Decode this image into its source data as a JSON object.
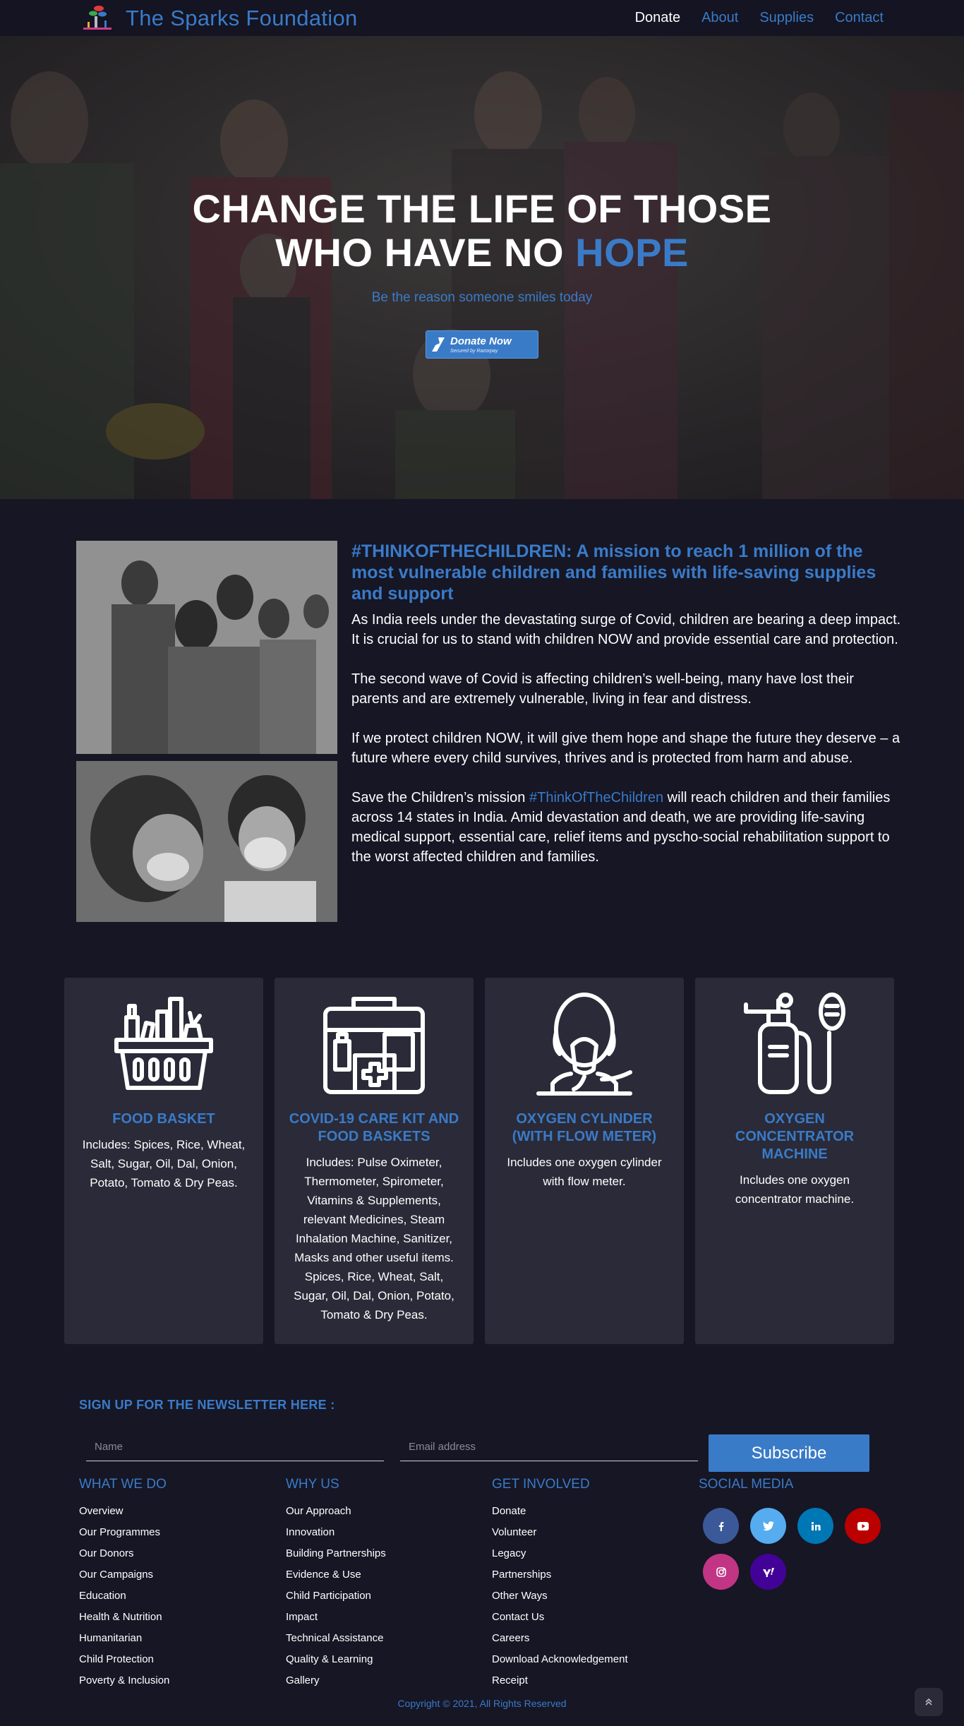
{
  "nav": {
    "brand": "The Sparks Foundation",
    "links": [
      "Donate",
      "About",
      "Supplies",
      "Contact"
    ],
    "active_color": "#ffffff",
    "link_color": "#3a7bc8"
  },
  "hero": {
    "title_line1": "CHANGE THE LIFE OF THOSE",
    "title_line2_prefix": "WHO HAVE NO",
    "title_line2_highlight": "HOPE",
    "subtitle": "Be the reason someone smiles today",
    "donate_button": {
      "label": "Donate Now",
      "sublabel": "Secured by Razorpay",
      "icon": "razorpay-icon"
    }
  },
  "mission": {
    "title": "#THINKOFTHECHILDREN: A mission to reach 1 million of the most vulnerable children and families with life-saving supplies and support",
    "paragraphs": [
      "As India reels under the devastating surge of Covid, children are bearing a deep impact. It is crucial for us to stand with children NOW and provide essential care and protection.",
      "The second wave of Covid is affecting children’s well-being, many have lost their parents and are extremely vulnerable, living in fear and distress.",
      "If we protect children NOW, it will give them hope and shape the future they deserve – a future where every child survives, thrives and is protected from harm and abuse."
    ],
    "last_para_prefix": "Save the Children’s mission",
    "last_para_highlight": "#ThinkOfTheChildren",
    "last_para_suffix": "will reach children and their families across 14 states in India. Amid devastation and death, we are providing life-saving medical support, essential care, relief items and pyscho-social rehabilitation support to the worst affected children and families."
  },
  "cards": [
    {
      "icon": "food-basket-icon",
      "title": "FOOD BASKET",
      "text": "Includes: Spices, Rice, Wheat, Salt, Sugar, Oil, Dal, Onion, Potato, Tomato & Dry Peas."
    },
    {
      "icon": "medical-kit-icon",
      "title": "COVID-19 CARE KIT AND FOOD BASKETS",
      "text": "Includes: Pulse Oximeter, Thermometer, Spirometer, Vitamins & Supplements, relevant Medicines, Steam Inhalation Machine, Sanitizer, Masks and other useful items. Spices, Rice, Wheat, Salt, Sugar, Oil, Dal, Onion, Potato, Tomato & Dry Peas."
    },
    {
      "icon": "oxygen-mask-icon",
      "title": "OXYGEN CYLINDER (WITH FLOW METER)",
      "text": "Includes one oxygen cylinder with flow meter."
    },
    {
      "icon": "oxygen-concentrator-icon",
      "title": "OXYGEN CONCENTRATOR MACHINE",
      "text": "Includes one oxygen concentrator machine."
    }
  ],
  "newsletter": {
    "title": "SIGN UP FOR THE NEWSLETTER HERE :",
    "name_placeholder": "Name",
    "email_placeholder": "Email address",
    "subscribe_label": "Subscribe"
  },
  "footer": {
    "what_we_do": {
      "heading": "WHAT WE DO",
      "items": [
        "Overview",
        "Our Programmes",
        "Our Donors",
        "Our Campaigns",
        "Education",
        "Health & Nutrition",
        "Humanitarian",
        "Child Protection",
        "Poverty & Inclusion"
      ]
    },
    "why_us": {
      "heading": "WHY US",
      "items": [
        "Our Approach",
        "Innovation",
        "Building Partnerships",
        "Evidence & Use",
        "Child Participation",
        "Impact",
        "Technical Assistance",
        "Quality & Learning",
        "Gallery"
      ]
    },
    "get_involved": {
      "heading": "GET INVOLVED",
      "items": [
        "Donate",
        "Volunteer",
        "Legacy",
        "Partnerships",
        "Other Ways",
        "Contact Us",
        "Careers",
        "Download Acknowledgement",
        "Receipt"
      ]
    },
    "social": {
      "heading": "SOCIAL MEDIA",
      "items": [
        {
          "icon": "facebook-icon",
          "color": "#3b5998",
          "glyph": "f"
        },
        {
          "icon": "twitter-icon",
          "color": "#55acee",
          "glyph": "t"
        },
        {
          "icon": "linkedin-icon",
          "color": "#0077b5",
          "glyph": "in"
        },
        {
          "icon": "youtube-icon",
          "color": "#bb0000",
          "glyph": "▶"
        },
        {
          "icon": "instagram-icon",
          "color": "#c13584",
          "glyph": "◎"
        },
        {
          "icon": "yahoo-icon",
          "color": "#430297",
          "glyph": "y!"
        }
      ]
    },
    "copyright": "Copyright © 2021, All Rights Reserved"
  },
  "colors": {
    "accent": "#3a7bc8",
    "background": "#161625",
    "card": "#2a2a38"
  }
}
